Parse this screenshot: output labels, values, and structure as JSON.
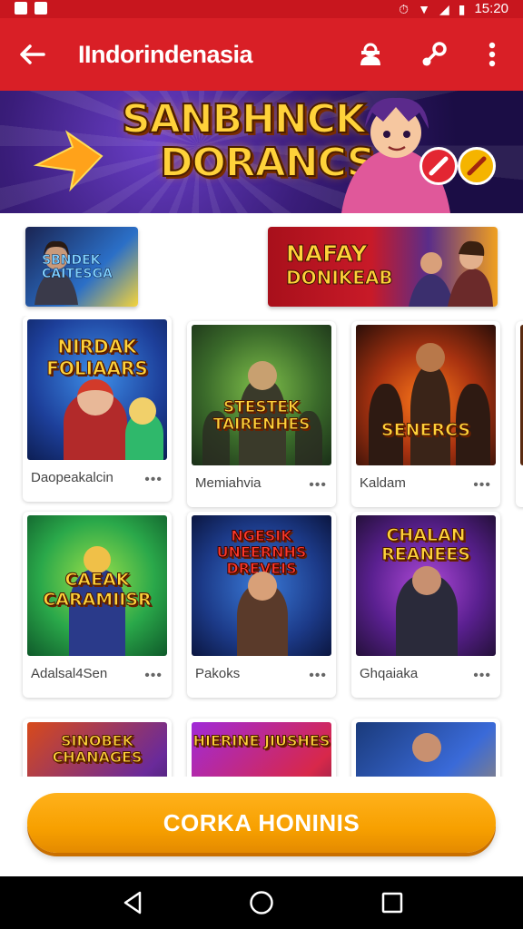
{
  "status_bar": {
    "time": "15:20",
    "icons": [
      "notification-icon",
      "gallery-icon",
      "alarm-icon",
      "wifi-icon",
      "signal-icon",
      "battery-icon"
    ]
  },
  "app_bar": {
    "title": "IIndorindenasia",
    "back_icon": "arrow-left-icon",
    "actions": [
      "user-icon",
      "link-icon",
      "more-vert-icon"
    ]
  },
  "hero": {
    "line1": "SANBHNCK",
    "line2": "DORANCS"
  },
  "promos": [
    {
      "text_line1": "SBNDEK",
      "text_line2": "CAITESGA"
    },
    {
      "text_line1": "NAFAY",
      "text_line2": "DONIKEAB"
    }
  ],
  "games": [
    {
      "name": "Daopeakalcin",
      "thumb_title": "NIRDAK FOLIAARS",
      "more": "•••"
    },
    {
      "name": "Memiahvia",
      "thumb_title": "STESTEK TAIRENHES",
      "more": "•••"
    },
    {
      "name": "Kaldam",
      "thumb_title": "SENERCS",
      "more": "•••"
    },
    {
      "name": "Adalsal4Sen",
      "thumb_title": "CAEAK CARAMIISR",
      "more": "•••"
    },
    {
      "name": "Pakoks",
      "thumb_title": "NGESIK UNEERNHS DREVEIS",
      "more": "•••"
    },
    {
      "name": "Ghqaiaka",
      "thumb_title": "CHALAN REANEES",
      "more": "•••"
    },
    {
      "name": "",
      "thumb_title": "SINOBEK CHANAGES",
      "more": ""
    },
    {
      "name": "",
      "thumb_title": "HIERINE JIUSHES",
      "more": ""
    },
    {
      "name": "",
      "thumb_title": "",
      "more": ""
    }
  ],
  "cta": {
    "label": "CORKA HONINIS"
  },
  "colors": {
    "primary": "#d91f26",
    "accent": "#f7a000",
    "status_bar": "#c8161e"
  }
}
